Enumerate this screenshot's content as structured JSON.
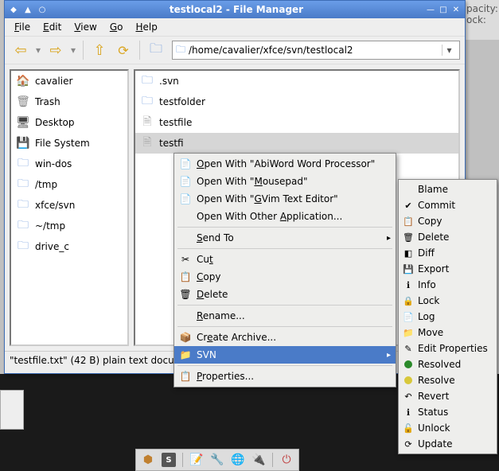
{
  "bg": {
    "opacity_label": "pacity:",
    "lock_label": "ock:"
  },
  "window": {
    "title": "testlocal2 - File Manager",
    "menubar": {
      "file": "File",
      "edit": "Edit",
      "view": "View",
      "go": "Go",
      "help": "Help"
    },
    "path": "/home/cavalier/xfce/svn/testlocal2",
    "sidebar": [
      {
        "icon": "home",
        "label": "cavalier"
      },
      {
        "icon": "trash",
        "label": "Trash"
      },
      {
        "icon": "desktop",
        "label": "Desktop"
      },
      {
        "icon": "fs",
        "label": "File System"
      },
      {
        "icon": "folder",
        "label": "win-dos"
      },
      {
        "icon": "folder",
        "label": "/tmp"
      },
      {
        "icon": "folder",
        "label": "xfce/svn"
      },
      {
        "icon": "folder",
        "label": "~/tmp"
      },
      {
        "icon": "folder",
        "label": "drive_c"
      }
    ],
    "files": [
      {
        "icon": "folder",
        "label": ".svn"
      },
      {
        "icon": "folder",
        "label": "testfolder"
      },
      {
        "icon": "file",
        "label": "testfile"
      },
      {
        "icon": "file",
        "label": "testfile.txt",
        "selected": true,
        "visible_label": "testfi"
      }
    ],
    "status": "\"testfile.txt\" (42 B) plain text docu"
  },
  "context_menu": [
    {
      "icon": "app",
      "label_pre": "",
      "u": "O",
      "label_post": "pen With \"AbiWord Word Processor\""
    },
    {
      "icon": "app",
      "label_pre": "Open With \"",
      "u": "M",
      "label_post": "ousepad\""
    },
    {
      "icon": "app",
      "label_pre": "Open With \"",
      "u": "G",
      "label_post": "Vim Text Editor\""
    },
    {
      "icon": "",
      "label_pre": "Open With Other ",
      "u": "A",
      "label_post": "pplication..."
    },
    {
      "sep": true
    },
    {
      "icon": "",
      "label_pre": "",
      "u": "S",
      "label_post": "end To",
      "submenu": true
    },
    {
      "sep": true
    },
    {
      "icon": "cut",
      "label_pre": "Cu",
      "u": "t",
      "label_post": ""
    },
    {
      "icon": "copy",
      "label_pre": "",
      "u": "C",
      "label_post": "opy"
    },
    {
      "icon": "delete",
      "label_pre": "",
      "u": "D",
      "label_post": "elete"
    },
    {
      "sep": true
    },
    {
      "icon": "",
      "label_pre": "",
      "u": "R",
      "label_post": "ename..."
    },
    {
      "sep": true
    },
    {
      "icon": "archive",
      "label_pre": "Cr",
      "u": "e",
      "label_post": "ate Archive..."
    },
    {
      "icon": "svn",
      "label_pre": "SVN",
      "u": "",
      "label_post": "",
      "submenu": true,
      "highlight": true
    },
    {
      "sep": true
    },
    {
      "icon": "props",
      "label_pre": "",
      "u": "P",
      "label_post": "roperties..."
    }
  ],
  "svn_submenu": [
    {
      "icon": "",
      "label": "Blame"
    },
    {
      "icon": "check",
      "label": "Commit"
    },
    {
      "icon": "copy",
      "label": "Copy"
    },
    {
      "icon": "delete",
      "label": "Delete"
    },
    {
      "icon": "diff",
      "label": "Diff"
    },
    {
      "icon": "save",
      "label": "Export"
    },
    {
      "icon": "info",
      "label": "Info"
    },
    {
      "icon": "lock",
      "label": "Lock"
    },
    {
      "icon": "log",
      "label": "Log"
    },
    {
      "icon": "move",
      "label": "Move"
    },
    {
      "icon": "edit",
      "label": "Edit Properties"
    },
    {
      "icon": "dot-g",
      "label": "Resolved"
    },
    {
      "icon": "dot-y",
      "label": "Resolve"
    },
    {
      "icon": "revert",
      "label": "Revert"
    },
    {
      "icon": "info",
      "label": "Status"
    },
    {
      "icon": "unlock",
      "label": "Unlock"
    },
    {
      "icon": "update",
      "label": "Update"
    }
  ]
}
